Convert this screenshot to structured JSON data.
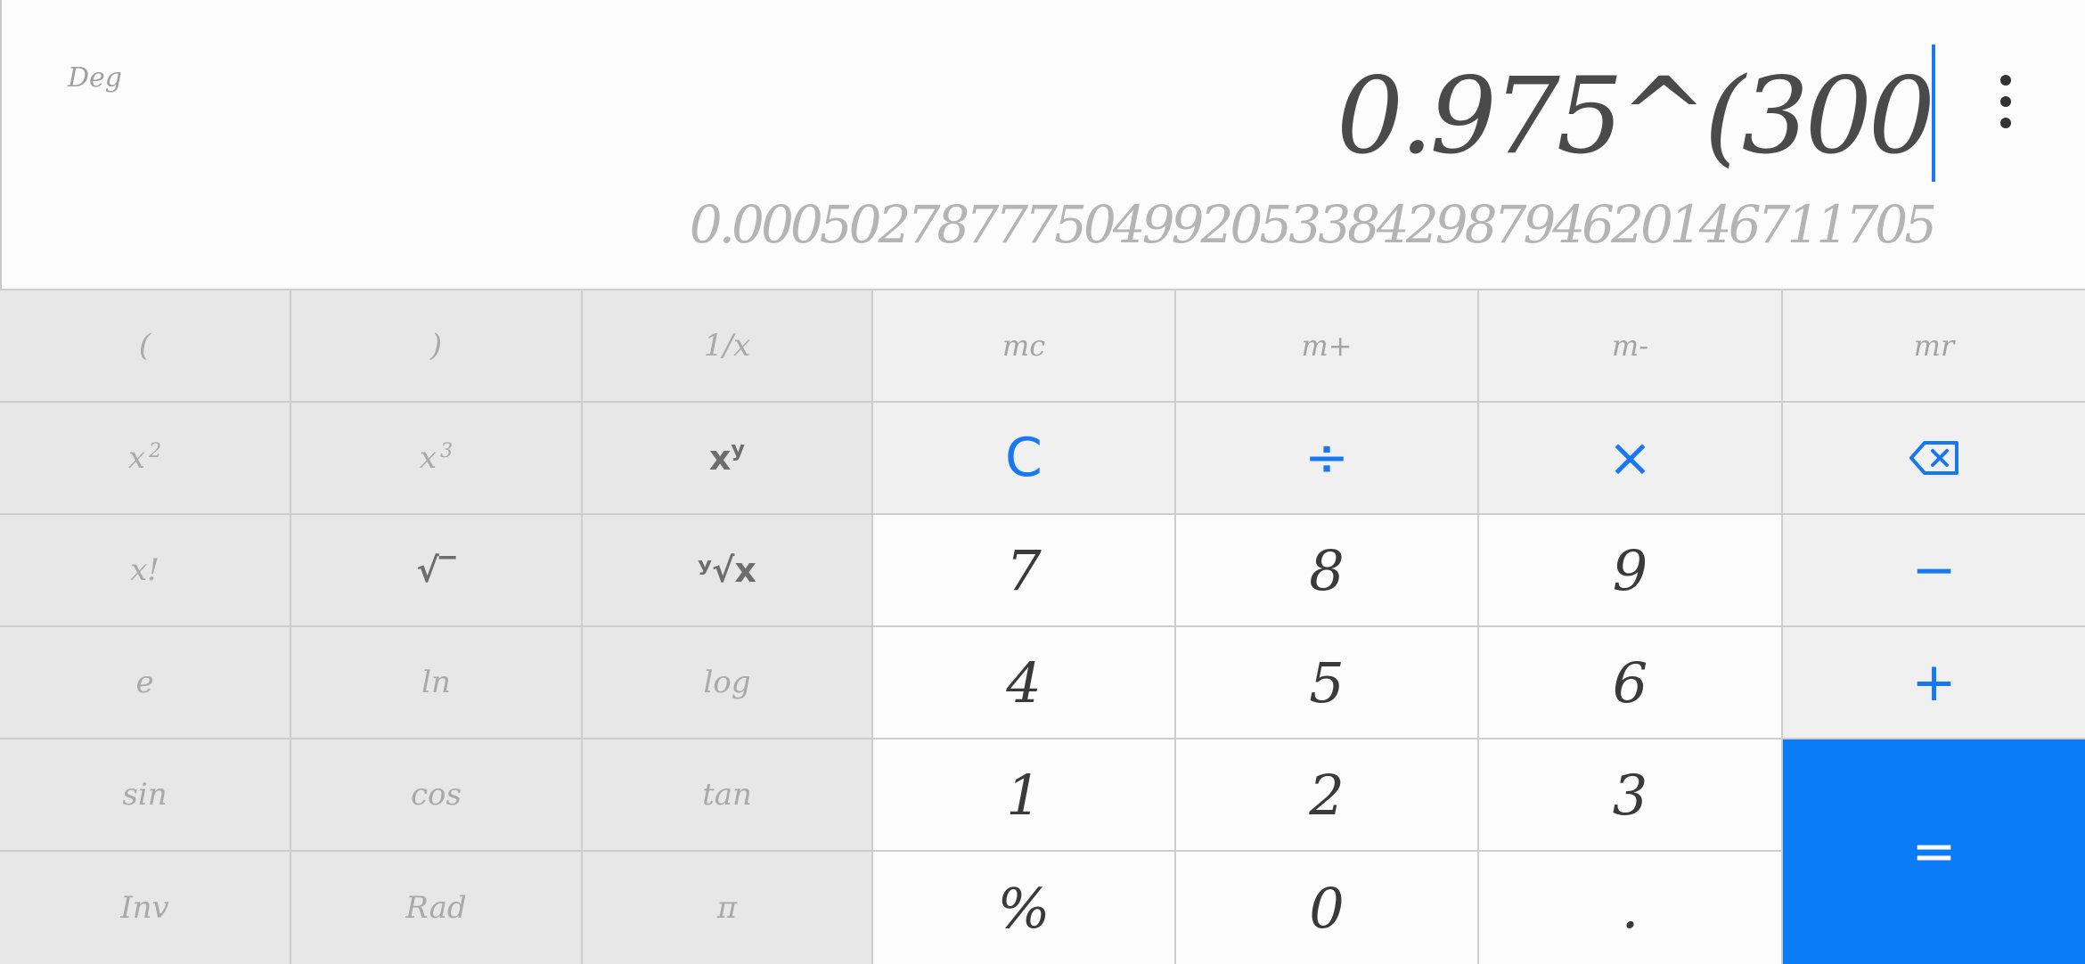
{
  "display": {
    "mode": "Deg",
    "expression": "0.975^(300",
    "result": "0.00050278777504992053384298794620146711705"
  },
  "keys": {
    "open_paren": "(",
    "close_paren": ")",
    "reciprocal": "1/x",
    "mc": "mc",
    "mplus": "m+",
    "mminus": "m-",
    "mr": "mr",
    "square_base": "x",
    "square_exp": "2",
    "cube_base": "x",
    "cube_exp": "3",
    "power_base": "x",
    "power_exp": "y",
    "clear": "C",
    "divide": "÷",
    "multiply": "×",
    "factorial": "x!",
    "sqrt": "√‾",
    "yroot": "ʸ√x",
    "seven": "7",
    "eight": "8",
    "nine": "9",
    "minus": "−",
    "e": "e",
    "ln": "ln",
    "log": "log",
    "four": "4",
    "five": "5",
    "six": "6",
    "plus": "+",
    "sin": "sin",
    "cos": "cos",
    "tan": "tan",
    "one": "1",
    "two": "2",
    "three": "3",
    "equals": "=",
    "inv": "Inv",
    "rad": "Rad",
    "pi": "π",
    "percent": "%",
    "zero": "0",
    "decimal": "."
  },
  "icons": {
    "more": "more-vertical-icon",
    "backspace": "backspace-icon"
  },
  "colors": {
    "accent": "#1877f2",
    "equals_bg": "#0a7cf8",
    "sci_bg": "#e7e7e7",
    "op_bg": "#f0f0f0",
    "num_bg": "#fcfcfc"
  }
}
